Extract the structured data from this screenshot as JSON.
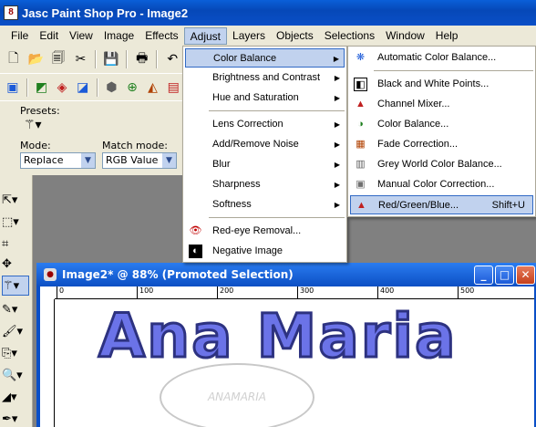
{
  "app": {
    "title": "Jasc Paint Shop Pro - Image2",
    "icon_text": "8"
  },
  "menubar": [
    "File",
    "Edit",
    "View",
    "Image",
    "Effects",
    "Adjust",
    "Layers",
    "Objects",
    "Selections",
    "Window",
    "Help"
  ],
  "active_menu": "Adjust",
  "tool_options": {
    "presets_label": "Presets:",
    "mode_label": "Mode:",
    "mode_value": "Replace",
    "match_label": "Match mode:",
    "match_value": "RGB Value"
  },
  "adjust_menu": {
    "items": [
      {
        "label": "Color Balance",
        "submenu": "▶"
      },
      {
        "label": "Brightness and Contrast",
        "submenu": "▶"
      },
      {
        "label": "Hue and Saturation",
        "submenu": "▶"
      },
      {
        "label": "Lens Correction",
        "submenu": "▶"
      },
      {
        "label": "Add/Remove Noise",
        "submenu": "▶"
      },
      {
        "label": "Blur",
        "submenu": "▶"
      },
      {
        "label": "Sharpness",
        "submenu": "▶"
      },
      {
        "label": "Softness",
        "submenu": "▶"
      },
      {
        "label": "Red-eye Removal..."
      },
      {
        "label": "Negative Image"
      }
    ]
  },
  "color_balance_menu": {
    "items": [
      {
        "label": "Automatic Color Balance..."
      },
      {
        "label": "Black and White Points..."
      },
      {
        "label": "Channel Mixer..."
      },
      {
        "label": "Color Balance..."
      },
      {
        "label": "Fade Correction..."
      },
      {
        "label": "Grey World Color Balance..."
      },
      {
        "label": "Manual Color Correction..."
      },
      {
        "label": "Red/Green/Blue...",
        "shortcut": "Shift+U"
      }
    ]
  },
  "image_window": {
    "title": "Image2*  @  88% (Promoted Selection)",
    "ruler_marks": [
      "0",
      "100",
      "200",
      "300",
      "400",
      "500"
    ],
    "canvas_text": "Ana Maria",
    "watermark": "ANAMARIA"
  }
}
